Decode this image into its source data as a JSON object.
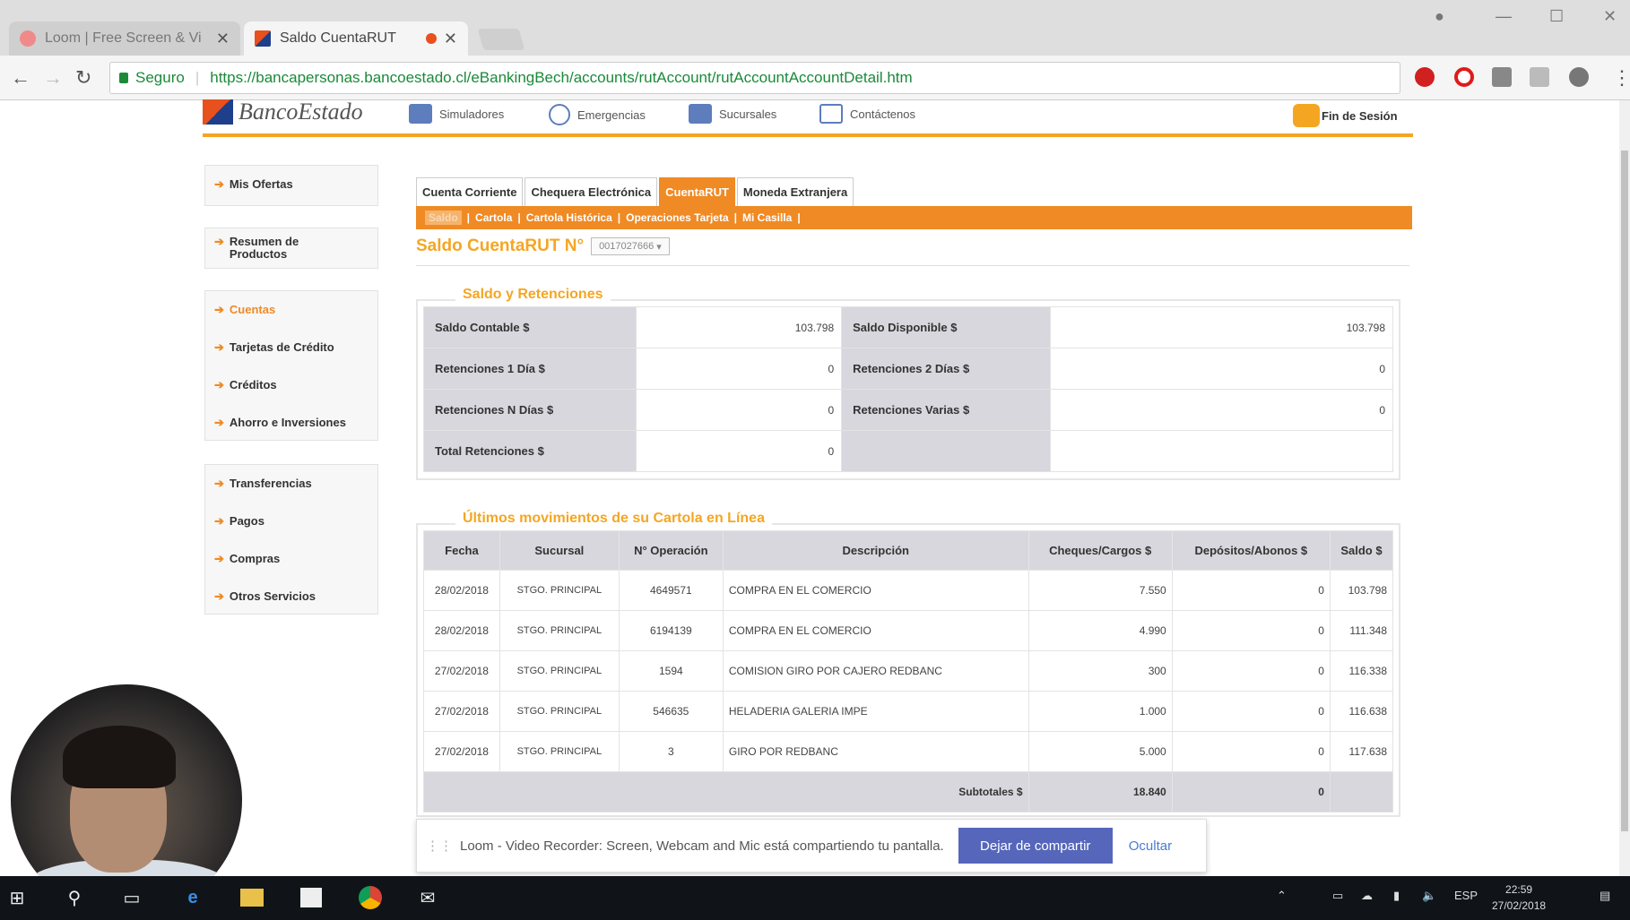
{
  "browser": {
    "tabs": [
      {
        "title": "Loom | Free Screen & Vi",
        "active": false
      },
      {
        "title": "Saldo CuentaRUT",
        "active": true
      }
    ],
    "secure_label": "Seguro",
    "url": "https://bancapersonas.bancoestado.cl/eBankingBech/accounts/rutAccount/rutAccountAccountDetail.htm"
  },
  "header": {
    "logo": "BancoEstado",
    "nav": [
      "Simuladores",
      "Emergencias",
      "Sucursales",
      "Contáctenos"
    ],
    "logout": "Fin de Sesión"
  },
  "sidebar": {
    "group1": [
      "Mis Ofertas"
    ],
    "group2": [
      "Resumen de Productos"
    ],
    "group3": [
      "Cuentas",
      "Tarjetas de Crédito",
      "Créditos",
      "Ahorro e Inversiones"
    ],
    "group4": [
      "Transferencias",
      "Pagos",
      "Compras",
      "Otros Servicios"
    ]
  },
  "tabs": [
    "Cuenta Corriente",
    "Chequera Electrónica",
    "CuentaRUT",
    "Moneda Extranjera"
  ],
  "subtabs": [
    "Saldo",
    "Cartola",
    "Cartola Histórica",
    "Operaciones Tarjeta",
    "Mi Casilla"
  ],
  "page": {
    "title": "Saldo CuentaRUT N°",
    "account": "0017027666"
  },
  "saldo": {
    "legend": "Saldo y Retenciones",
    "rows": [
      {
        "l1": "Saldo Contable $",
        "v1": "103.798",
        "l2": "Saldo Disponible $",
        "v2": "103.798"
      },
      {
        "l1": "Retenciones 1 Día $",
        "v1": "0",
        "l2": "Retenciones 2 Días $",
        "v2": "0"
      },
      {
        "l1": "Retenciones N Días $",
        "v1": "0",
        "l2": "Retenciones Varias $",
        "v2": "0"
      },
      {
        "l1": "Total Retenciones $",
        "v1": "0",
        "l2": "",
        "v2": ""
      }
    ]
  },
  "movements": {
    "legend": "Últimos movimientos de su Cartola en Línea",
    "headers": [
      "Fecha",
      "Sucursal",
      "N° Operación",
      "Descripción",
      "Cheques/Cargos $",
      "Depósitos/Abonos $",
      "Saldo $"
    ],
    "rows": [
      {
        "fecha": "28/02/2018",
        "sucursal": "STGO. PRINCIPAL",
        "op": "4649571",
        "desc": "COMPRA EN EL COMERCIO",
        "cargo": "7.550",
        "abono": "0",
        "saldo": "103.798"
      },
      {
        "fecha": "28/02/2018",
        "sucursal": "STGO. PRINCIPAL",
        "op": "6194139",
        "desc": "COMPRA EN EL COMERCIO",
        "cargo": "4.990",
        "abono": "0",
        "saldo": "111.348"
      },
      {
        "fecha": "27/02/2018",
        "sucursal": "STGO. PRINCIPAL",
        "op": "1594",
        "desc": "COMISION GIRO POR CAJERO REDBANC",
        "cargo": "300",
        "abono": "0",
        "saldo": "116.338"
      },
      {
        "fecha": "27/02/2018",
        "sucursal": "STGO. PRINCIPAL",
        "op": "546635",
        "desc": "HELADERIA GALERIA IMPE",
        "cargo": "1.000",
        "abono": "0",
        "saldo": "116.638"
      },
      {
        "fecha": "27/02/2018",
        "sucursal": "STGO. PRINCIPAL",
        "op": "3",
        "desc": "GIRO POR REDBANC",
        "cargo": "5.000",
        "abono": "0",
        "saldo": "117.638"
      }
    ],
    "subtotal_label": "Subtotales $",
    "subtotal_cargos": "18.840",
    "subtotal_abonos": "0"
  },
  "loom": {
    "message": "Loom - Video Recorder: Screen, Webcam and Mic está compartiendo tu pantalla.",
    "stop": "Dejar de compartir",
    "hide": "Ocultar"
  },
  "taskbar": {
    "lang": "ESP",
    "time": "22:59",
    "date": "27/02/2018"
  }
}
